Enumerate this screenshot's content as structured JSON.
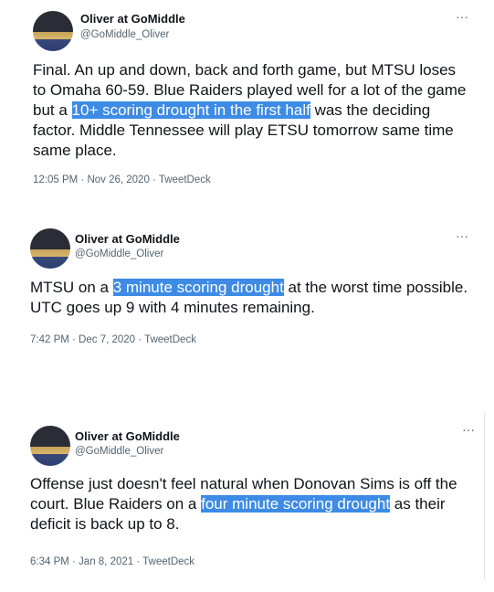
{
  "tweets": [
    {
      "author_name": "Oliver at GoMiddle",
      "handle": "@GoMiddle_Oliver",
      "text_before": "Final. An up and down, back and forth game, but MTSU loses to Omaha 60-59. Blue Raiders played well for a lot of the game but a ",
      "highlight": "10+ scoring drought in the first half",
      "text_after": " was the deciding factor. Middle Tennessee will play ETSU tomorrow same time same place.",
      "timestamp": "12:05 PM · Nov 26, 2020 · TweetDeck",
      "more_icon": "···"
    },
    {
      "author_name": "Oliver at GoMiddle",
      "handle": "@GoMiddle_Oliver",
      "text_before": "MTSU on a ",
      "highlight": "3 minute scoring drought",
      "text_after": " at the worst time possible. UTC goes up 9 with 4 minutes remaining.",
      "timestamp": "7:42 PM · Dec 7, 2020 · TweetDeck",
      "more_icon": "···"
    },
    {
      "author_name": "Oliver at GoMiddle",
      "handle": "@GoMiddle_Oliver",
      "text_before": "Offense just doesn't feel natural when Donovan Sims is off the court. Blue Raiders on a ",
      "highlight": "four minute scoring drought",
      "text_after": " as their deficit is back up to 8.",
      "timestamp": "6:34 PM · Jan 8, 2021 · TweetDeck",
      "more_icon": "···"
    }
  ],
  "colors": {
    "highlight": "#3d8be5",
    "secondary_text": "#536471"
  }
}
